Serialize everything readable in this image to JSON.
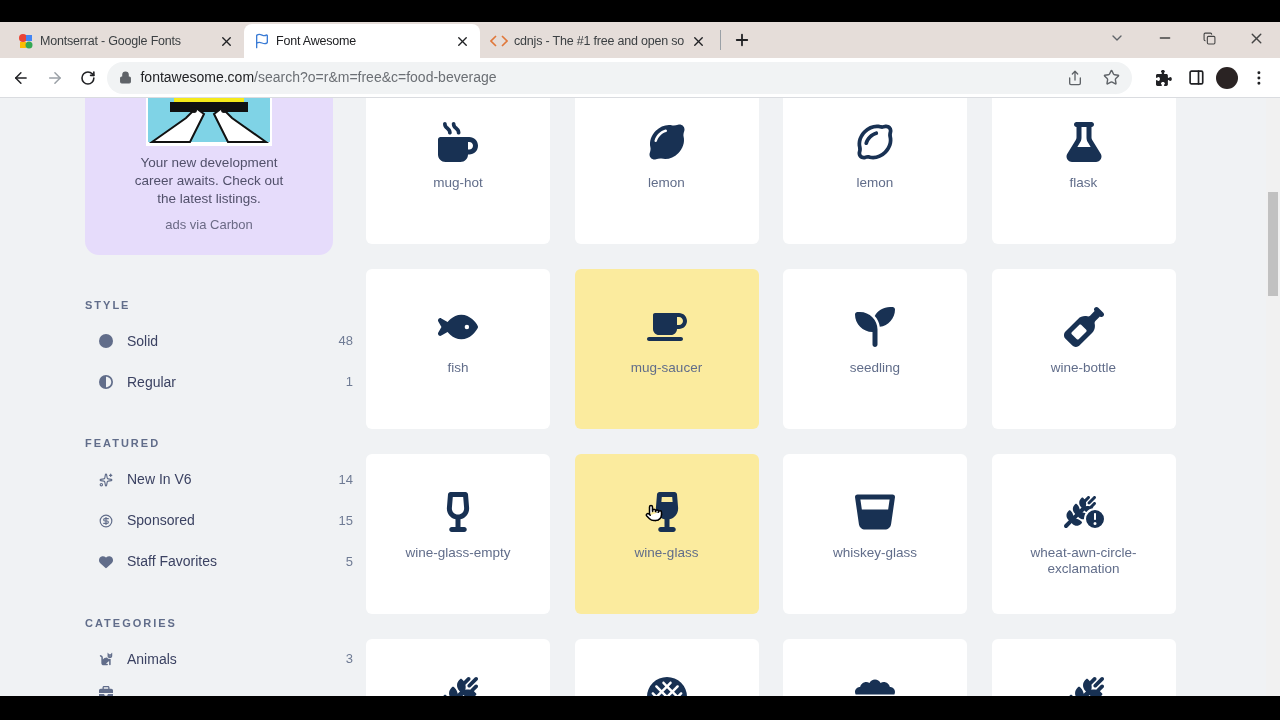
{
  "browser": {
    "tabs": [
      {
        "title": "Montserrat - Google Fonts",
        "selected": false
      },
      {
        "title": "Font Awesome",
        "selected": true
      },
      {
        "title": "cdnjs - The #1 free and open so",
        "selected": false
      }
    ],
    "address": {
      "domain": "fontawesome.com",
      "path": "/search?o=r&m=free&c=food-beverage"
    }
  },
  "ad": {
    "text": "Your new development career awaits. Check out the latest listings.",
    "via": "ads via Carbon"
  },
  "sidebar": [
    {
      "heading": "STYLE",
      "items": [
        {
          "label": "Solid",
          "count": "48"
        },
        {
          "label": "Regular",
          "count": "1"
        }
      ]
    },
    {
      "heading": "FEATURED",
      "items": [
        {
          "label": "New In V6",
          "count": "14"
        },
        {
          "label": "Sponsored",
          "count": "15"
        },
        {
          "label": "Staff Favorites",
          "count": "5"
        }
      ]
    },
    {
      "heading": "CATEGORIES",
      "items": [
        {
          "label": "Animals",
          "count": "3"
        }
      ]
    }
  ],
  "icons": [
    {
      "label": "mug-hot",
      "selected": false
    },
    {
      "label": "lemon",
      "selected": false
    },
    {
      "label": "lemon",
      "selected": false
    },
    {
      "label": "flask",
      "selected": false
    },
    {
      "label": "fish",
      "selected": false
    },
    {
      "label": "mug-saucer",
      "selected": true
    },
    {
      "label": "seedling",
      "selected": false
    },
    {
      "label": "wine-bottle",
      "selected": false
    },
    {
      "label": "wine-glass-empty",
      "selected": false
    },
    {
      "label": "wine-glass",
      "selected": true
    },
    {
      "label": "whiskey-glass",
      "selected": false
    },
    {
      "label": "wheat-awn-circle-exclamation",
      "selected": false
    },
    {
      "selected": false
    },
    {
      "selected": false
    },
    {
      "selected": false
    },
    {
      "selected": false
    }
  ]
}
